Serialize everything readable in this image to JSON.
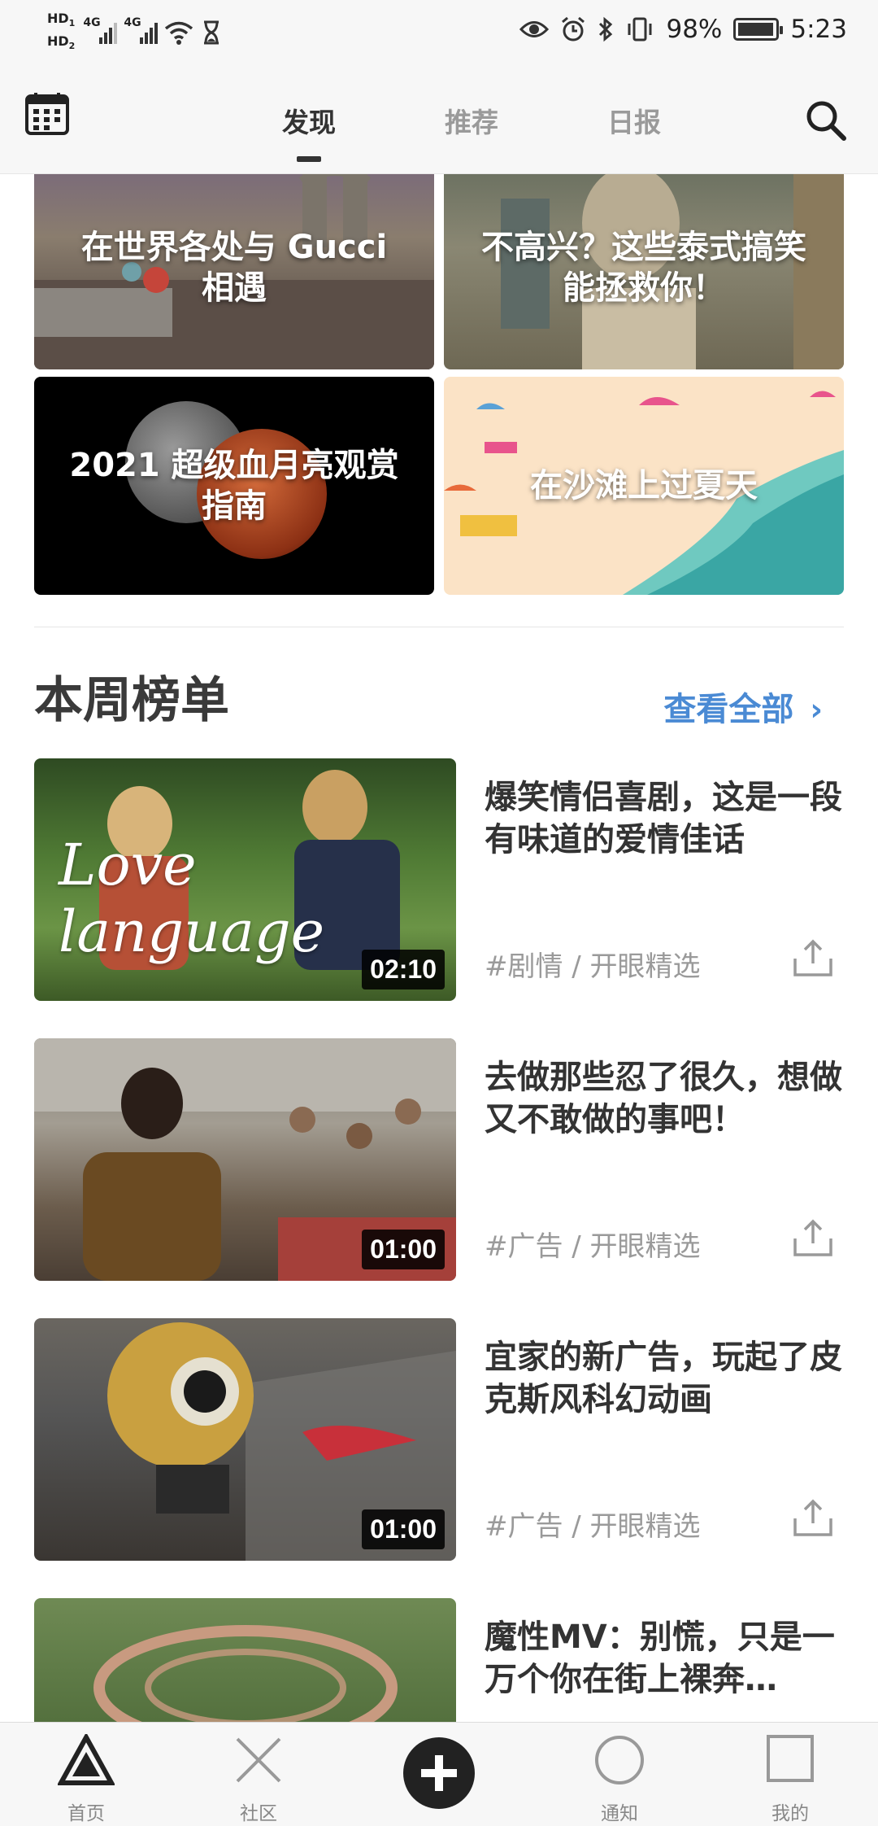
{
  "status": {
    "left_hd1": "HD",
    "left_hd1_sub": "1",
    "left_hd2": "HD",
    "left_hd2_sub": "2",
    "net1": "4G",
    "net2": "4G",
    "battery_percent": "98%",
    "battery_level": 0.98,
    "time": "5:23"
  },
  "nav": {
    "tabs": [
      {
        "label": "发现",
        "active": true
      },
      {
        "label": "推荐",
        "active": false
      },
      {
        "label": "日报",
        "active": false
      }
    ]
  },
  "cards": [
    {
      "title": "在世界各处与 Gucci 相遇"
    },
    {
      "title": "不高兴？这些泰式搞笑能拯救你！"
    },
    {
      "title": "2021 超级血月亮观赏指南"
    },
    {
      "title": "在沙滩上过夏天"
    }
  ],
  "weekly": {
    "title": "本周榜单",
    "see_all": "查看全部",
    "items": [
      {
        "title": "爆笑情侣喜剧，这是一段有味道的爱情佳话",
        "tag": "#剧情 / 开眼精选",
        "duration": "02:10",
        "thumb_text": "Love language"
      },
      {
        "title": "去做那些忍了很久，想做又不敢做的事吧！",
        "tag": "#广告 / 开眼精选",
        "duration": "01:00"
      },
      {
        "title": "宜家的新广告，玩起了皮克斯风科幻动画",
        "tag": "#广告 / 开眼精选",
        "duration": "01:00"
      },
      {
        "title": "魔性MV：别慌，只是一万个你在街上裸奔…",
        "tag": "",
        "duration": ""
      }
    ]
  },
  "bottom_nav": [
    {
      "label": "首页",
      "icon": "triangle-icon"
    },
    {
      "label": "社区",
      "icon": "cross-icon"
    },
    {
      "label": "",
      "icon": "plus-icon"
    },
    {
      "label": "通知",
      "icon": "circle-icon"
    },
    {
      "label": "我的",
      "icon": "square-icon"
    }
  ],
  "colors": {
    "accent": "#4a8ad4",
    "text_primary": "#333333",
    "text_secondary": "#9a9a9a",
    "bar_bg": "#f7f7f7"
  }
}
